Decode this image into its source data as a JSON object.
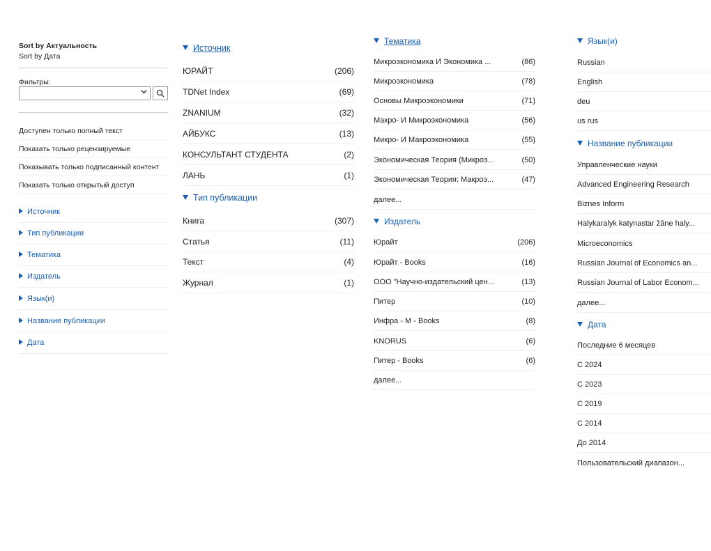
{
  "sort": {
    "relevance": "Sort by Актуальность",
    "date": "Sort by Дата"
  },
  "filters": {
    "label": "Фильтры:",
    "value": ""
  },
  "options": [
    "Доступен только полный текст",
    "Показать только рецензируемые",
    "Показывать только подписанный контент",
    "Показать только открытый доступ"
  ],
  "facets_collapsed": [
    "Источник",
    "Тип публикации",
    "Тематика",
    "Издатель",
    "Язык(и)",
    "Название публикации",
    "Дата"
  ],
  "source": {
    "title": "Источник",
    "items": [
      {
        "label": "ЮРАЙТ",
        "count": "(206)"
      },
      {
        "label": "TDNet Index",
        "count": "(69)"
      },
      {
        "label": "ZNANIUM",
        "count": "(32)"
      },
      {
        "label": "АЙБУКС",
        "count": "(13)"
      },
      {
        "label": "КОНСУЛЬТАНТ СТУДЕНТА",
        "count": "(2)"
      },
      {
        "label": "ЛАНЬ",
        "count": "(1)"
      }
    ]
  },
  "pubtype": {
    "title": "Тип публикации",
    "items": [
      {
        "label": "Книга",
        "count": "(307)"
      },
      {
        "label": "Статья",
        "count": "(11)"
      },
      {
        "label": "Текст",
        "count": "(4)"
      },
      {
        "label": "Журнал",
        "count": "(1)"
      }
    ]
  },
  "subject": {
    "title": "Тематика",
    "items": [
      {
        "label": "Микроэкономика И Экономика ...",
        "count": "(86)"
      },
      {
        "label": "Микроэкономика",
        "count": "(78)"
      },
      {
        "label": "Основы Микроэкономики",
        "count": "(71)"
      },
      {
        "label": "Макро- И Микроэкономика",
        "count": "(56)"
      },
      {
        "label": "Микро- И Макроэкономика",
        "count": "(55)"
      },
      {
        "label": "Экономическая Теория (Микроэ...",
        "count": "(50)"
      },
      {
        "label": "Экономическая Теория: Макроэ...",
        "count": "(47)"
      }
    ],
    "more": "далее..."
  },
  "publisher": {
    "title": "Издатель",
    "items": [
      {
        "label": "Юрайт",
        "count": "(206)"
      },
      {
        "label": "Юрайт - Books",
        "count": "(16)"
      },
      {
        "label": "ООО \"Научно-издательский цен...",
        "count": "(13)"
      },
      {
        "label": "Питер",
        "count": "(10)"
      },
      {
        "label": "Инфра - М - Books",
        "count": "(8)"
      },
      {
        "label": "KNORUS",
        "count": "(6)"
      },
      {
        "label": "Питер - Books",
        "count": "(6)"
      }
    ],
    "more": "далее..."
  },
  "language": {
    "title": "Язык(и)",
    "items": [
      "Russian",
      "English",
      "deu",
      "us rus"
    ]
  },
  "pubname": {
    "title": "Название публикации",
    "items": [
      "Управленческие науки",
      "Advanced Engineering Research",
      "Biznes Inform",
      "Halykaralyk katynastar žāne haly...",
      "Microeconomics",
      "Russian Journal of Economics an...",
      "Russian Journal of Labor Econom..."
    ],
    "more": "далее..."
  },
  "date": {
    "title": "Дата",
    "items": [
      "Последние 6 месяцев",
      "С 2024",
      "С 2023",
      "С 2019",
      "С 2014",
      "До 2014",
      "Пользовательский диапазон..."
    ]
  },
  "colors": {
    "link": "#1a5fb4",
    "divider": "#eeeeee"
  },
  "icons": {
    "dropdown": "chevron-down-icon",
    "search": "search-icon",
    "expanded": "triangle-down-icon",
    "collapsed": "triangle-right-icon"
  }
}
